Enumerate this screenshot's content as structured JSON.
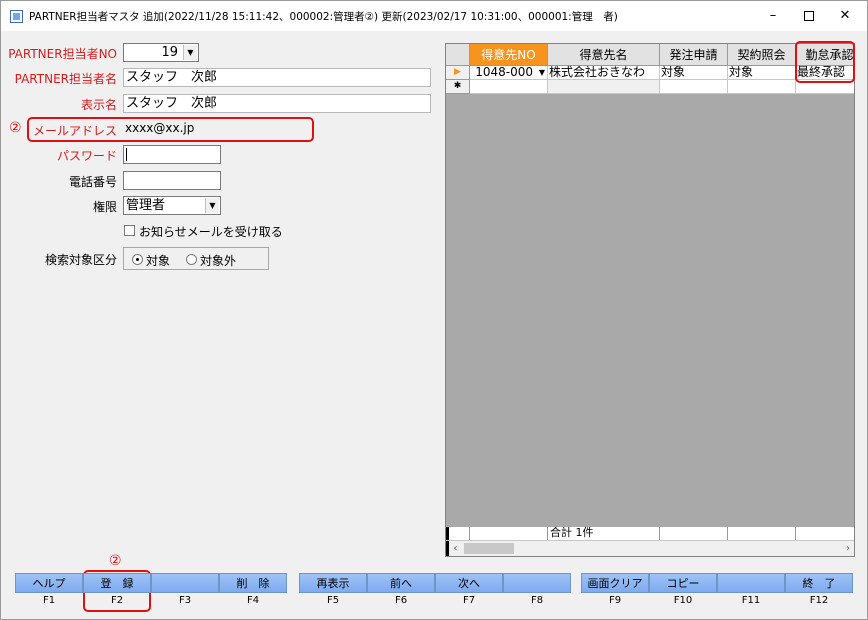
{
  "window": {
    "title": "PARTNER担当者マスタ 追加(2022/11/28 15:11:42、000002:管理者②) 更新(2023/02/17 10:31:00、000001:管理　者)",
    "minimize": "–",
    "maximize": "",
    "close": "✕"
  },
  "form": {
    "partner_no": {
      "label": "PARTNER担当者NO",
      "value": "19"
    },
    "partner_name": {
      "label": "PARTNER担当者名",
      "value": "スタッフ　次郎"
    },
    "display_name": {
      "label": "表示名",
      "value": "スタッフ　次郎"
    },
    "email": {
      "label": "メールアドレス",
      "value": "xxxx@xx.jp",
      "marker": "②"
    },
    "password": {
      "label": "パスワード",
      "value": ""
    },
    "phone": {
      "label": "電話番号",
      "value": ""
    },
    "role": {
      "label": "権限",
      "value": "管理者"
    },
    "notify": {
      "label": "お知らせメールを受け取る",
      "checked": false
    },
    "search_scope": {
      "label": "検索対象区分",
      "options": [
        "対象",
        "対象外"
      ],
      "selected": "対象"
    }
  },
  "grid": {
    "columns": [
      "得意先NO",
      "得意先名",
      "発注申請",
      "契約照会",
      "勤怠承認"
    ],
    "rows": [
      {
        "indicator": "▶",
        "cells": [
          "1048-000",
          "株式会社おきなわ",
          "対象",
          "対象",
          "最終承認"
        ]
      }
    ],
    "new_row_indicator": "✱",
    "footer": "合計 1件",
    "scroll_left": "‹",
    "scroll_right": "›"
  },
  "annotations": {
    "fkey_marker": "②"
  },
  "fkeys": [
    {
      "label": "ヘルプ",
      "key": "F1"
    },
    {
      "label": "登　録",
      "key": "F2"
    },
    {
      "label": "",
      "key": "F3"
    },
    {
      "label": "削　除",
      "key": "F4"
    },
    {
      "label": "再表示",
      "key": "F5"
    },
    {
      "label": "前へ",
      "key": "F6"
    },
    {
      "label": "次へ",
      "key": "F7"
    },
    {
      "label": "",
      "key": "F8"
    },
    {
      "label": "画面クリア",
      "key": "F9"
    },
    {
      "label": "コピー",
      "key": "F10"
    },
    {
      "label": "",
      "key": "F11"
    },
    {
      "label": "終　了",
      "key": "F12"
    }
  ],
  "colors": {
    "accent_header": "#f7941d",
    "annotation_red": "#e01010",
    "fkey_blue": "#8fb6f2"
  }
}
